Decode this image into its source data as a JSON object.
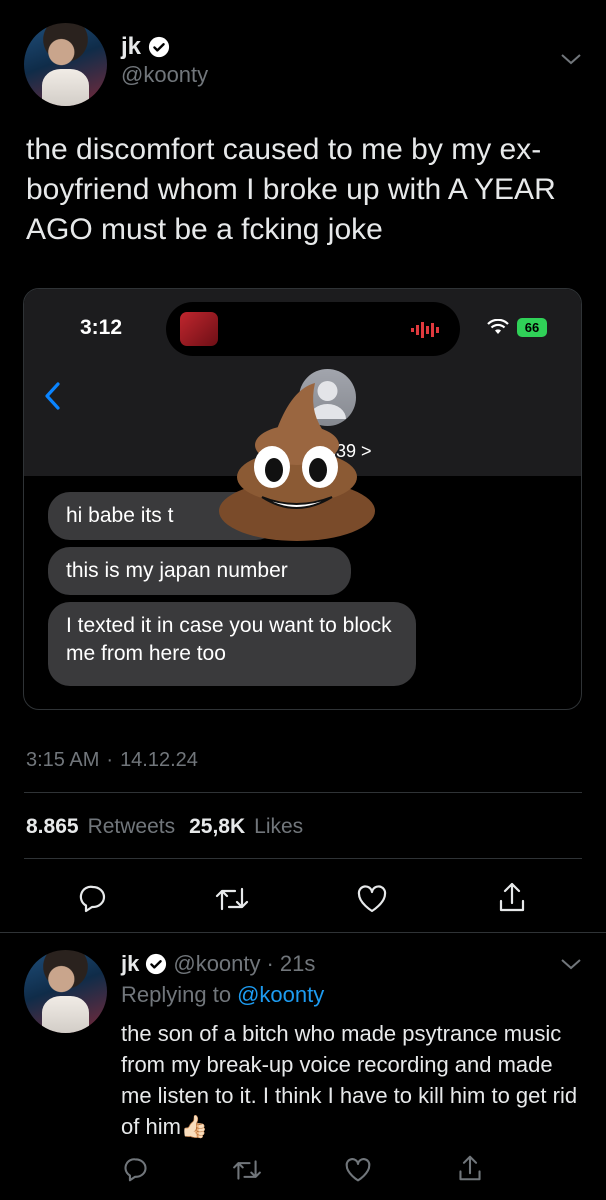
{
  "tweet": {
    "display_name": "jk",
    "handle": "@koonty",
    "text": "the discomfort caused to me by my ex-boyfriend whom I broke up with A YEAR AGO must be a fcking joke",
    "time": "3:15 AM",
    "separator": "·",
    "date": "14.12.24",
    "retweets_count": "8.865",
    "retweets_label": "Retweets",
    "likes_count": "25,8K",
    "likes_label": "Likes"
  },
  "embedded_screenshot": {
    "status_time": "3:12",
    "battery": "66",
    "contact_number_partial": "2839 >",
    "messages": [
      "hi babe its t",
      "this is my japan number",
      "I texted it in case you want to block me from here too"
    ],
    "sticker_emoji": "💩"
  },
  "reply": {
    "display_name": "jk",
    "handle": "@koonty",
    "separator": "·",
    "age": "21s",
    "replying_prefix": "Replying to",
    "replying_to": "@koonty",
    "text": "the son of a bitch who made psytrance music from my break-up voice recording and made me listen to it. I think I have to kill him to get rid of him",
    "emoji": "👍🏻"
  },
  "icons": [
    "verified-badge-icon",
    "chevron-down-icon",
    "back-chevron-icon",
    "wifi-icon",
    "signal-bars-icon",
    "person-icon",
    "reply-icon",
    "retweet-icon",
    "like-icon",
    "share-icon"
  ],
  "colors": {
    "background": "#000000",
    "text": "#e7e9ea",
    "muted": "#71767b",
    "accent": "#1d9bf0",
    "battery": "#30d158"
  }
}
